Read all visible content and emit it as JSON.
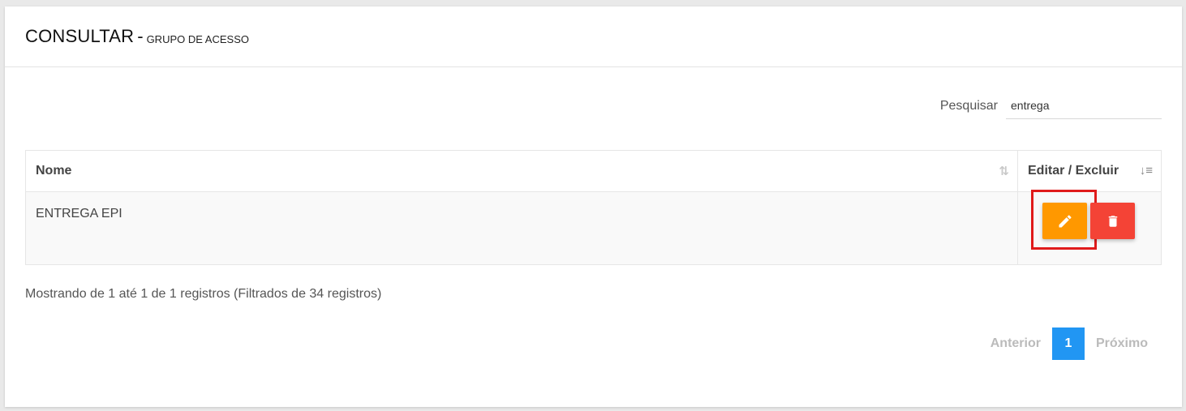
{
  "header": {
    "title": "CONSULTAR",
    "separator": "-",
    "subtitle": "GRUPO DE ACESSO"
  },
  "search": {
    "label": "Pesquisar",
    "value": "entrega"
  },
  "table": {
    "columns": [
      {
        "label": "Nome",
        "sort_icon": "sort-neutral-icon"
      },
      {
        "label": "Editar / Excluir",
        "sort_icon": "sort-amount-icon"
      }
    ],
    "rows": [
      {
        "name": "ENTREGA EPI"
      }
    ],
    "actions": {
      "edit_icon": "pencil-icon",
      "delete_icon": "trash-icon",
      "edit_color": "#ff9800",
      "delete_color": "#f44336"
    }
  },
  "info_text": "Mostrando de 1 até 1 de 1 registros (Filtrados de 34 registros)",
  "pagination": {
    "previous": "Anterior",
    "current": "1",
    "next": "Próximo",
    "active_color": "#2196f3"
  }
}
